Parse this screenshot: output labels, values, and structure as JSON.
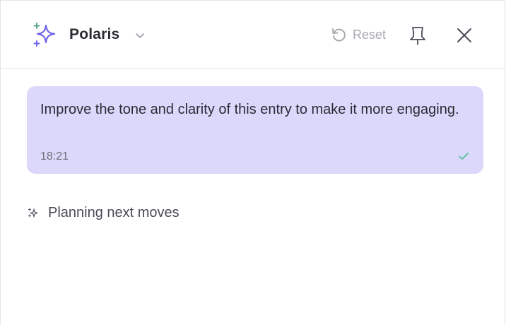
{
  "header": {
    "assistant_name": "Polaris",
    "reset_label": "Reset"
  },
  "icons": {
    "brand": "sparkle-icon",
    "chevron": "chevron-down-icon",
    "reset": "undo-icon",
    "pin": "pin-icon",
    "close": "close-icon",
    "check": "check-icon",
    "status": "sparkle-icon"
  },
  "colors": {
    "accent": "#6c63e6",
    "bubble": "#dcd8fb",
    "check": "#4cbf8f"
  },
  "conversation": {
    "messages": [
      {
        "text": "Improve the tone and clarity of this entry to make it more engaging.",
        "time": "18:21"
      }
    ],
    "status": "Planning next moves"
  }
}
